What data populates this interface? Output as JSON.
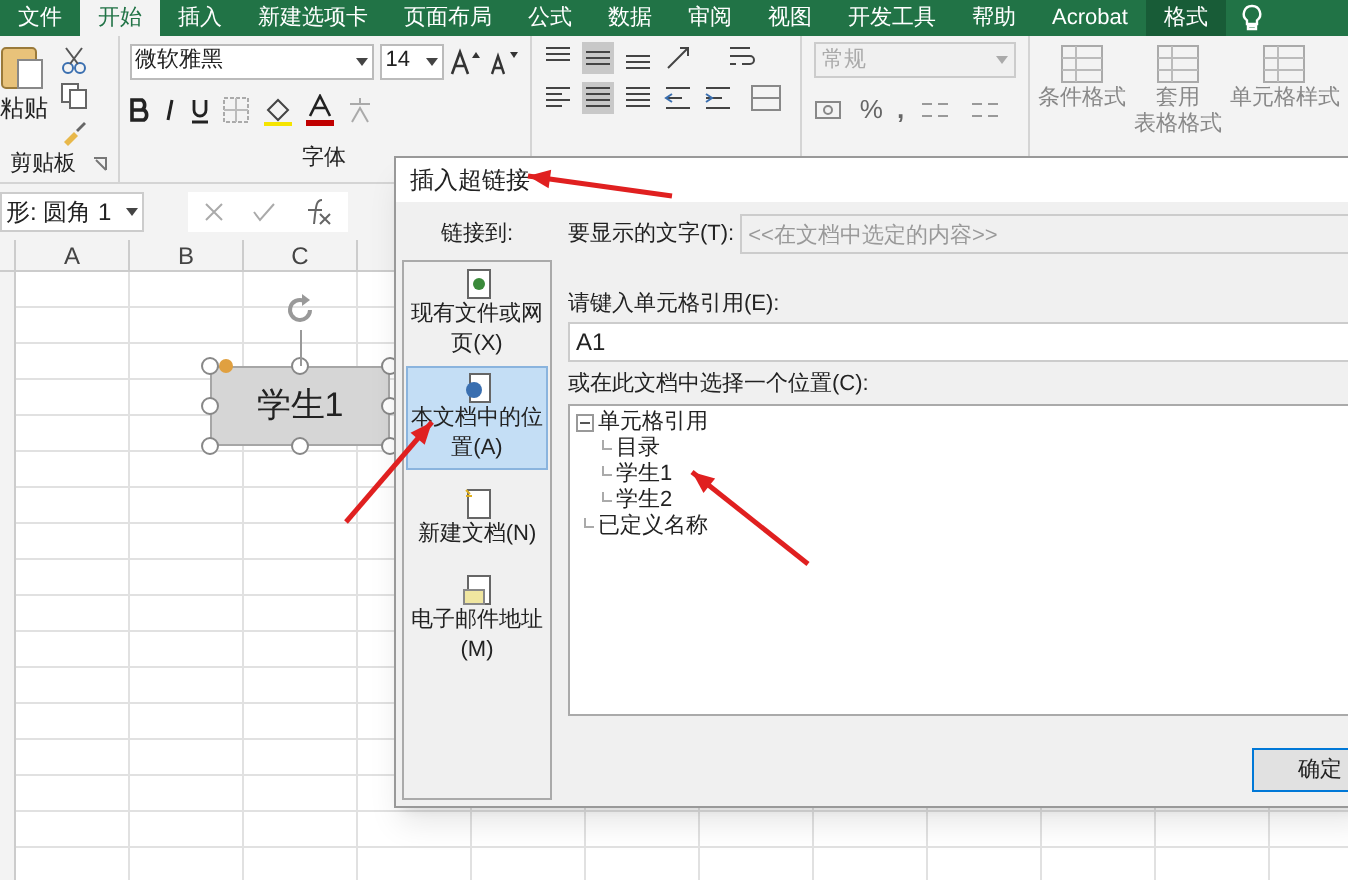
{
  "ribbon_tabs": [
    {
      "label": "文件",
      "selected": false,
      "contextual": false
    },
    {
      "label": "开始",
      "selected": true,
      "contextual": false
    },
    {
      "label": "插入",
      "selected": false,
      "contextual": false
    },
    {
      "label": "新建选项卡",
      "selected": false,
      "contextual": false
    },
    {
      "label": "页面布局",
      "selected": false,
      "contextual": false
    },
    {
      "label": "公式",
      "selected": false,
      "contextual": false
    },
    {
      "label": "数据",
      "selected": false,
      "contextual": false
    },
    {
      "label": "审阅",
      "selected": false,
      "contextual": false
    },
    {
      "label": "视图",
      "selected": false,
      "contextual": false
    },
    {
      "label": "开发工具",
      "selected": false,
      "contextual": false
    },
    {
      "label": "帮助",
      "selected": false,
      "contextual": false
    },
    {
      "label": "Acrobat",
      "selected": false,
      "contextual": false
    },
    {
      "label": "格式",
      "selected": false,
      "contextual": true
    }
  ],
  "clipboard": {
    "paste_label": "粘贴",
    "group_label": "剪贴板"
  },
  "font": {
    "name": "微软雅黑",
    "size": "14",
    "group_label": "字体"
  },
  "number": {
    "format": "常规",
    "percent": "%",
    "comma": ","
  },
  "styles": [
    {
      "lines": [
        "条件格式"
      ]
    },
    {
      "lines": [
        "套用",
        "表格格式"
      ]
    },
    {
      "lines": [
        "单元格样式"
      ]
    }
  ],
  "name_box": "形: 圆角 1",
  "columns": [
    "A",
    "B",
    "C"
  ],
  "shape": {
    "text": "学生1"
  },
  "dialog": {
    "title": "插入超链接",
    "link_to_label": "链接到:",
    "link_types": [
      {
        "label": "现有文件或网页(X)",
        "selected": false
      },
      {
        "label": "本文档中的位置(A)",
        "selected": true
      },
      {
        "label": "新建文档(N)",
        "selected": false
      },
      {
        "label": "电子邮件地址(M)",
        "selected": false
      }
    ],
    "display_text": {
      "label": "要显示的文字(T):",
      "value": "<<在文档中选定的内容>>",
      "disabled": true
    },
    "cell_ref": {
      "label": "请键入单元格引用(E):",
      "value": "A1"
    },
    "place_label": "或在此文档中选择一个位置(C):",
    "tree": [
      {
        "label": "单元格引用",
        "expanded": true,
        "children": [
          {
            "label": "目录"
          },
          {
            "label": "学生1"
          },
          {
            "label": "学生2"
          }
        ]
      },
      {
        "label": "已定义名称"
      }
    ],
    "ok_button": "确定"
  }
}
